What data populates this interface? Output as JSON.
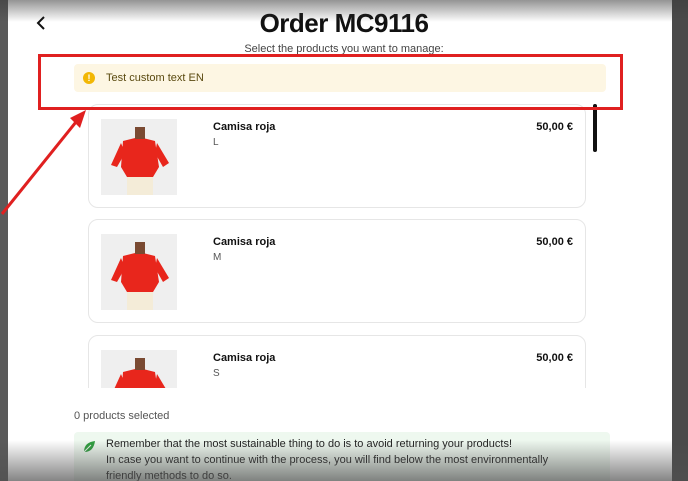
{
  "header": {
    "back_icon": "chevron-left-icon",
    "title": "Order MC9116",
    "subtitle": "Select the products you want to manage:"
  },
  "notice": {
    "icon": "warning-circle-icon",
    "text": "Test custom text EN",
    "background": "#fdf6e3",
    "icon_color": "#f2b705"
  },
  "products": [
    {
      "name": "Camisa roja",
      "size": "L",
      "price": "50,00 €"
    },
    {
      "name": "Camisa roja",
      "size": "M",
      "price": "50,00 €"
    },
    {
      "name": "Camisa roja",
      "size": "S",
      "price": "50,00 €"
    }
  ],
  "selection": {
    "count_text": "0 products selected"
  },
  "eco_message": {
    "icon": "leaf-icon",
    "line1": "Remember that the most sustainable thing to do is to avoid returning your products!",
    "line2": "In case you want to continue with the process, you will find below the most environmentally",
    "line3": "friendly methods to do so."
  },
  "colors": {
    "annotation": "#e02020",
    "shirt": "#e8261c",
    "leaf": "#2e9e3e"
  }
}
